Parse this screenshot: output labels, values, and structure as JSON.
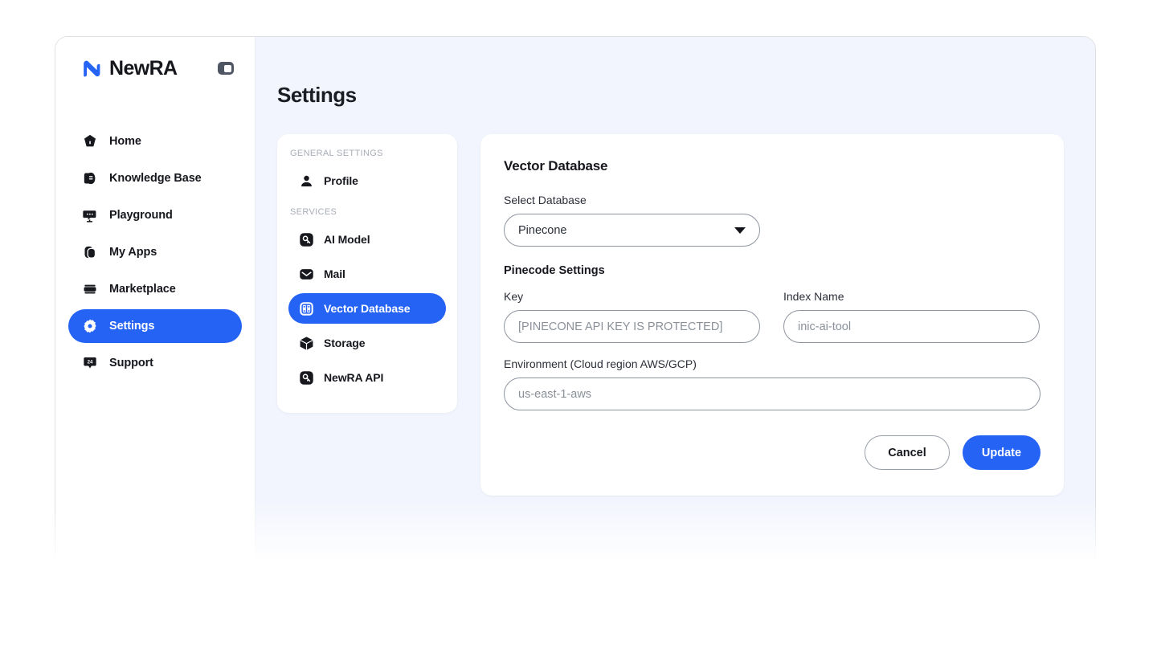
{
  "brand": {
    "name": "NewRA",
    "logo_icon": "newra-logo-icon",
    "toggle_icon": "sidebar-collapse-icon"
  },
  "sidebar": {
    "items": [
      {
        "label": "Home",
        "icon": "home-icon",
        "active": false
      },
      {
        "label": "Knowledge Base",
        "icon": "knowledge-base-icon",
        "active": false
      },
      {
        "label": "Playground",
        "icon": "playground-icon",
        "active": false
      },
      {
        "label": "My Apps",
        "icon": "my-apps-icon",
        "active": false
      },
      {
        "label": "Marketplace",
        "icon": "marketplace-icon",
        "active": false
      },
      {
        "label": "Settings",
        "icon": "gear-icon",
        "active": true
      },
      {
        "label": "Support",
        "icon": "support-24-icon",
        "active": false
      }
    ]
  },
  "header": {
    "title": "Settings"
  },
  "settings_nav": {
    "groups": [
      {
        "label": "GENERAL SETTINGS",
        "items": [
          {
            "label": "Profile",
            "icon": "person-icon",
            "active": false
          }
        ]
      },
      {
        "label": "SERVICES",
        "items": [
          {
            "label": "AI Model",
            "icon": "key-icon",
            "active": false
          },
          {
            "label": "Mail",
            "icon": "envelope-icon",
            "active": false
          },
          {
            "label": "Vector Database",
            "icon": "database-icon",
            "active": true
          },
          {
            "label": "Storage",
            "icon": "cube-icon",
            "active": false
          },
          {
            "label": "NewRA API",
            "icon": "key-icon",
            "active": false
          }
        ]
      }
    ]
  },
  "form": {
    "title": "Vector Database",
    "select_database": {
      "label": "Select Database",
      "value": "Pinecone",
      "caret_icon": "chevron-down-icon",
      "options": [
        "Pinecone"
      ]
    },
    "section_title": "Pinecode Settings",
    "key": {
      "label": "Key",
      "value": "",
      "placeholder": "[PINECONE API KEY IS PROTECTED]"
    },
    "index_name": {
      "label": "Index Name",
      "value": "",
      "placeholder": "inic-ai-tool"
    },
    "environment": {
      "label": "Environment (Cloud region AWS/GCP)",
      "value": "",
      "placeholder": "us-east-1-aws"
    },
    "cancel_label": "Cancel",
    "update_label": "Update"
  },
  "colors": {
    "accent": "#2563F5",
    "main_bg": "#F2F5FD",
    "card_bg": "#FFFFFF",
    "text": "#16181D",
    "muted": "#8A9099",
    "section_label": "#A8ADB7"
  }
}
